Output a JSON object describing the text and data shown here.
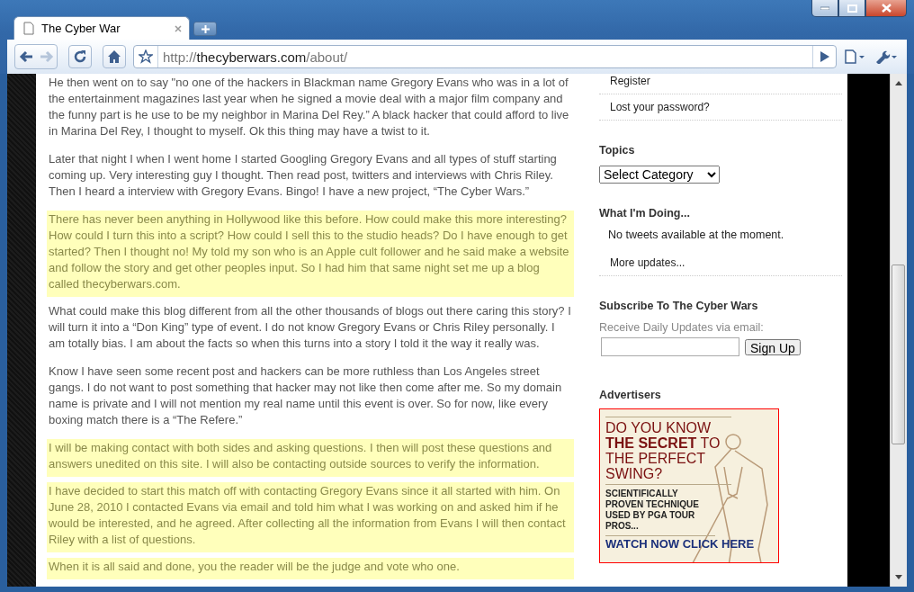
{
  "window": {
    "tab_title": "The Cyber War",
    "back_enabled": true,
    "forward_enabled": false,
    "url": {
      "scheme": "http://",
      "host": "thecyberwars.com",
      "path": "/about/"
    }
  },
  "article": {
    "paragraphs": [
      {
        "text": "He then went on to say \"no one of the hackers in Blackman name Gregory Evans who was in a lot of the entertainment magazines last year when he signed a movie deal with a major film company and the funny part is he use to be my neighbor in Marina Del Rey.” A black hacker that could afford to live in Marina Del Rey, I thought to myself.  Ok this thing may have a twist to it.",
        "highlighted": false
      },
      {
        "text": "Later that night I when I went home I started Googling Gregory Evans and all types of stuff starting coming up.  Very interesting guy I thought.  Then read post, twitters and interviews with Chris Riley.  Then I heard a interview with Gregory Evans. Bingo! I have a new project, “The Cyber Wars.”",
        "highlighted": false
      },
      {
        "text": "There has never been anything in Hollywood like this before. How could make this more interesting? How could I turn this into a script? How could I sell this to the studio heads?  Do I have enough to get started?  Then I thought no!  My told my son who is an Apple cult follower and he said make a website and follow the story and get other peoples input.  So I had him that same night set me up a blog called thecyberwars.com.",
        "highlighted": true
      },
      {
        "text": "What could make this blog different from all the other thousands of blogs out there caring this story?  I will turn it into a “Don King” type of event.  I do not know Gregory Evans or Chris Riley personally. I am totally bias.  I am about the facts so when this turns into a story I told it the way it really was.",
        "highlighted": false
      },
      {
        "text": "Know I have seen some recent post and hackers can be more ruthless than Los Angeles street gangs.  I do not want to post something that hacker may not like then come after me.  So my domain name is private and I will not mention my real name until this event is over. So for now, like every boxing match there is a “The Refere.”",
        "highlighted": false
      },
      {
        "text": "I will be making contact with both sides and asking questions.  I then will post these questions and answers unedited on this site.  I will also be contacting outside sources to verify the information.",
        "highlighted": true
      },
      {
        "text": "I have decided to start this match off with contacting Gregory Evans since it all started with him.  On June 28, 2010 I contacted Evans via email and told him what I was working on and asked him if he would be interested, and he agreed.   After collecting all the information from Evans I will then contact Riley with a list of questions.",
        "highlighted": true
      },
      {
        "text": "When it is all said and done, you the reader will be the judge and vote who one.",
        "highlighted": true
      }
    ]
  },
  "sidebar": {
    "meta_links": [
      "Register",
      "Lost your password?"
    ],
    "topics": {
      "heading": "Topics",
      "select_value": "Select Category"
    },
    "doing": {
      "heading": "What I'm Doing...",
      "status": "No tweets available at the moment.",
      "more_link": "More updates..."
    },
    "subscribe": {
      "heading": "Subscribe To The Cyber Wars",
      "label": "Receive Daily Updates via email:",
      "button": "Sign Up"
    },
    "advertisers": {
      "heading": "Advertisers",
      "ad": {
        "headline": "DO YOU KNOW **THE SECRET** TO THE PERFECT SWING?",
        "subtext": "SCIENTIFICALLY PROVEN TECHNIQUE USED BY PGA TOUR PROS...",
        "cta": "WATCH NOW CLICK HERE"
      }
    }
  }
}
